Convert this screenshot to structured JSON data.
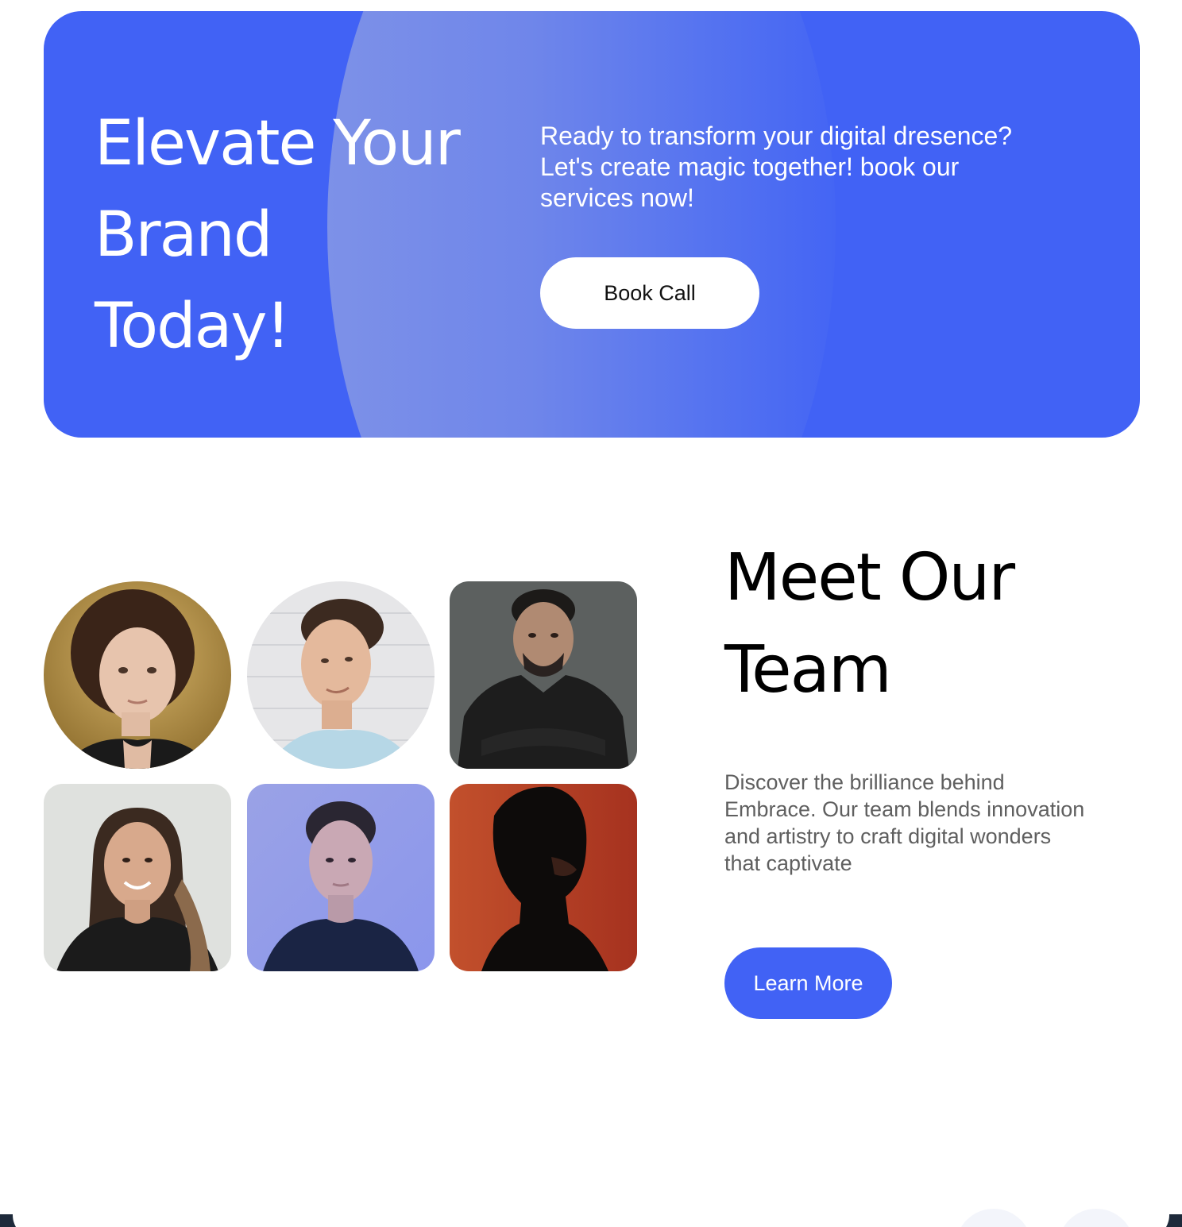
{
  "cta": {
    "headline_line1": "Elevate Your",
    "headline_line2": "Brand",
    "headline_line3": "Today!",
    "text_line1": "Ready to transform your digital dresence?",
    "text_line2": "Let's create magic together! book our",
    "text_line3": "services now!",
    "button_label": "Book Call",
    "accent_color": "#4162f5"
  },
  "team": {
    "title_line1": "Meet Our",
    "title_line2": "Team",
    "desc_line1": "Discover the brilliance behind",
    "desc_line2": "Embrace. Our team blends innovation",
    "desc_line3": "and artistry to craft digital wonders",
    "desc_line4": "that captivate",
    "button_label": "Learn More",
    "members": [
      {
        "photo": "portrait-woman-curly-hair-gold-background"
      },
      {
        "photo": "portrait-man-white-brick-background"
      },
      {
        "photo": "portrait-man-black-hoodie-arms-crossed"
      },
      {
        "photo": "portrait-woman-smiling-long-hair"
      },
      {
        "photo": "portrait-woman-blue-lighting"
      },
      {
        "photo": "portrait-man-silhouette-orange-background"
      }
    ]
  }
}
